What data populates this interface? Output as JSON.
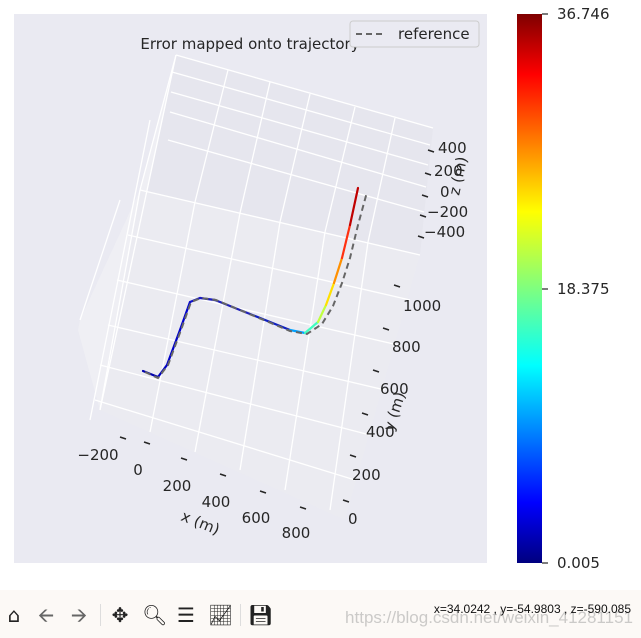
{
  "chart_data": {
    "type": "line3d",
    "title": "Error mapped onto trajectory",
    "legend": {
      "entries": [
        "reference"
      ],
      "placement": "top-right"
    },
    "xlabel": "x (m)",
    "ylabel": "y (m)",
    "zlabel": "z (m)",
    "x_ticks": [
      "−200",
      "0",
      "200",
      "400",
      "600",
      "800"
    ],
    "y_ticks": [
      "0",
      "200",
      "400",
      "600",
      "800",
      "1000"
    ],
    "z_ticks": [
      "400",
      "200",
      "0",
      "−200",
      "−400"
    ],
    "colorbar": {
      "min": 0.005,
      "max": 36.746,
      "ticks": [
        "36.746",
        "18.375",
        "0.005"
      ],
      "colormap": "jet"
    },
    "grid": true,
    "background": "#eaeaf2"
  },
  "toolbar": {
    "icons": [
      "home-icon",
      "back-icon",
      "forward-icon",
      "pan-icon",
      "zoom-icon",
      "configure-subplots-icon",
      "edit-axis-icon",
      "save-icon"
    ],
    "coords": "x=34.0242     , y=-54.9803     , z=-590.085",
    "watermark": "https://blog.csdn.net/weixin_41281151"
  }
}
